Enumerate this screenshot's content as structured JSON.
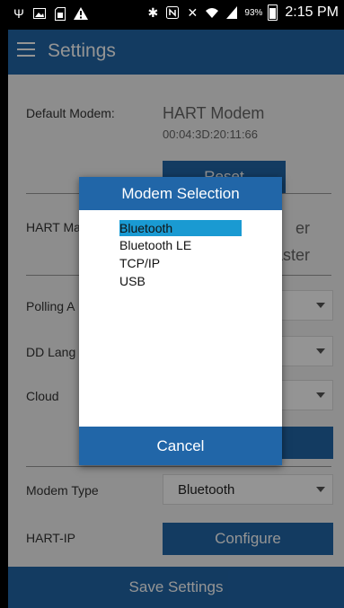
{
  "status_bar": {
    "left_icons": [
      "usb-icon",
      "image-icon",
      "sd-card-icon",
      "warning-icon"
    ],
    "right_icons": [
      "bluetooth-icon",
      "nfc-icon",
      "mute-icon",
      "wifi-icon",
      "signal-icon"
    ],
    "battery": "93%",
    "time": "2:15 PM"
  },
  "toolbar": {
    "title": "Settings",
    "menu_icon": "hamburger-menu-icon"
  },
  "settings": {
    "default_modem_label": "Default Modem:",
    "default_modem_value": "HART Modem",
    "default_modem_address": "00:04:3D:20:11:66",
    "reset_button": "Reset",
    "hart_master_label": "HART Ma",
    "hart_master_value_1": "er",
    "hart_master_value_2": "aster",
    "polling_label": "Polling A",
    "dd_language_label": "DD Lang",
    "cloud_label": "Cloud",
    "modem_type_label": "Modem Type",
    "modem_type_value": "Bluetooth",
    "hart_ip_label": "HART-IP",
    "configure_button": "Configure",
    "save_button": "Save Settings"
  },
  "dialog": {
    "title": "Modem Selection",
    "options": [
      {
        "label": "Bluetooth",
        "selected": true
      },
      {
        "label": "Bluetooth LE",
        "selected": false
      },
      {
        "label": "TCP/IP",
        "selected": false
      },
      {
        "label": "USB",
        "selected": false
      }
    ],
    "cancel": "Cancel"
  },
  "colors": {
    "primary": "#2166a8",
    "selection": "#1a9ad2",
    "overlay": "rgba(0,0,0,0.42)"
  }
}
